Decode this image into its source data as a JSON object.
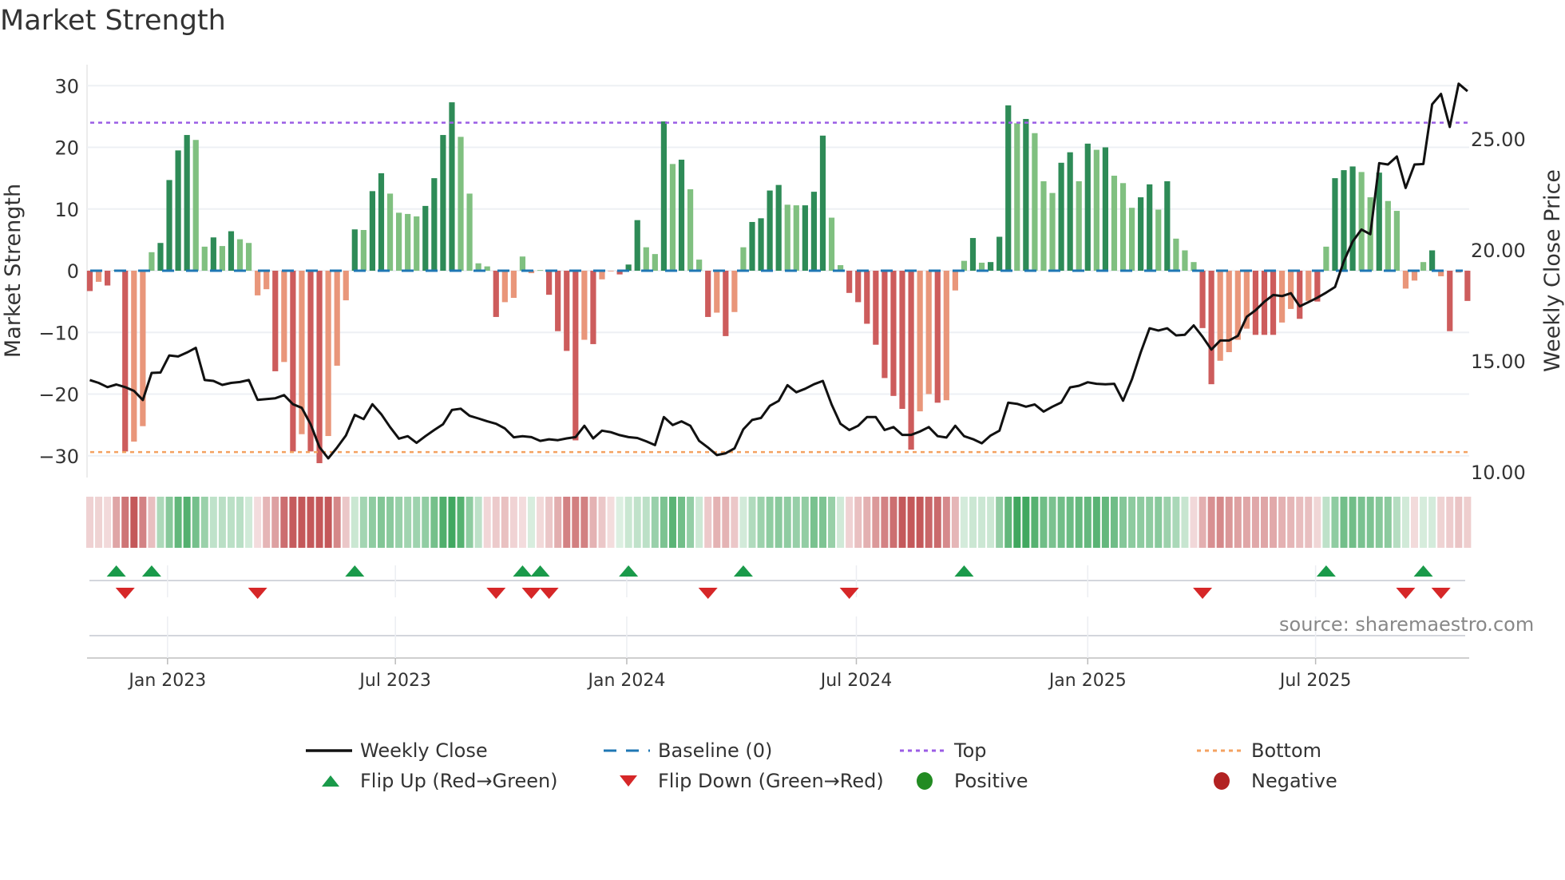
{
  "title": "Market Strength",
  "source": "source: sharemaestro.com",
  "colors": {
    "bar_pos_strong": "#2e8b57",
    "bar_pos_weak": "#80c080",
    "bar_neg_strong": "#cd5c5c",
    "bar_neg_weak": "#e9967a",
    "heat_pos": "#3fa75e",
    "heat_neg": "#c4585a",
    "close": "#111111",
    "baseline": "#1f77b4",
    "top": "#9b5de5",
    "bottom": "#f4a261",
    "flip_up": "#1a9a4a",
    "flip_down": "#d62728",
    "positive": "#228b22",
    "negative": "#b22222"
  },
  "legend": [
    {
      "key": "close",
      "label": "Weekly Close",
      "symbol": "line"
    },
    {
      "key": "baseline",
      "label": "Baseline (0)",
      "symbol": "dash"
    },
    {
      "key": "top",
      "label": "Top",
      "symbol": "dot"
    },
    {
      "key": "bottom",
      "label": "Bottom",
      "symbol": "dot"
    },
    {
      "key": "flip_up",
      "label": "Flip Up (Red→Green)",
      "symbol": "up"
    },
    {
      "key": "flip_down",
      "label": "Flip Down (Green→Red)",
      "symbol": "down"
    },
    {
      "key": "positive",
      "label": "Positive",
      "symbol": "circle"
    },
    {
      "key": "negative",
      "label": "Negative",
      "symbol": "circle"
    }
  ],
  "chart_data": {
    "type": "bar",
    "title": "Market Strength",
    "ylabel": "Market Strength",
    "y2label": "Weekly Close Price",
    "ylim": [
      -33.6,
      33.4
    ],
    "yticks": [
      "30",
      "20",
      "10",
      "0",
      "−10",
      "−20",
      "−30"
    ],
    "ytick_values": [
      30,
      20,
      10,
      0,
      -10,
      -20,
      -30
    ],
    "y2ticks": [
      "25.00",
      "20.00",
      "15.00",
      "10.00"
    ],
    "y2tick_values": [
      25,
      20,
      15,
      10
    ],
    "x_frequency": "weekly",
    "xticks": [
      {
        "label": "Jan 2023",
        "week_index": 8.8
      },
      {
        "label": "Jul 2023",
        "week_index": 34.6
      },
      {
        "label": "Jan 2024",
        "week_index": 60.8
      },
      {
        "label": "Jul 2024",
        "week_index": 86.8
      },
      {
        "label": "Jan 2025",
        "week_index": 113.0
      },
      {
        "label": "Jul 2025",
        "week_index": 138.8
      }
    ],
    "top_level": 24,
    "bottom_level": -29.4,
    "baseline": 0,
    "strength": [
      -3.3,
      -1.8,
      -2.4,
      0.1,
      -29.3,
      -27.7,
      -25.2,
      3,
      4.5,
      14.7,
      19.5,
      22,
      21.2,
      3.9,
      5.4,
      4,
      6.4,
      5.1,
      4.5,
      -4,
      -3,
      -16.3,
      -14.8,
      -29.3,
      -26.5,
      -29.3,
      -31.2,
      -26.8,
      -15.4,
      -4.8,
      6.7,
      6.6,
      12.9,
      15.8,
      12.5,
      9.4,
      9.2,
      8.8,
      10.5,
      15,
      22,
      27.3,
      21.7,
      12.5,
      1.2,
      0.7,
      -7.5,
      -5.1,
      -4.4,
      2.3,
      -0.4,
      0.1,
      -3.9,
      -9.8,
      -13,
      -27.5,
      -11.2,
      -11.9,
      -1.4,
      -0.1,
      -0.6,
      1,
      8.2,
      3.8,
      2.7,
      24.2,
      17.3,
      18,
      13.2,
      1.8,
      -7.5,
      -6.8,
      -10.6,
      -6.7,
      3.8,
      7.9,
      8.5,
      13,
      13.9,
      10.7,
      10.6,
      10.6,
      12.8,
      21.9,
      8.6,
      0.9,
      -3.6,
      -5.1,
      -8.6,
      -12,
      -17.4,
      -20.3,
      -22.4,
      -29,
      -22.8,
      -20,
      -21.4,
      -21,
      -3.2,
      1.6,
      5.3,
      1.3,
      1.4,
      5.5,
      26.8,
      23.9,
      24.6,
      22.3,
      14.5,
      12.6,
      17.5,
      19.2,
      14.5,
      20.6,
      19.6,
      20.0,
      15.4,
      14.2,
      10.2,
      11.9,
      14,
      9.9,
      14.5,
      5.2,
      3.3,
      1.4,
      -9.3,
      -18.4,
      -14.6,
      -13.2,
      -11.2,
      -9.4,
      -10.4,
      -10.4,
      -10.4,
      -8.4,
      -6.2,
      -7.8,
      -4.9,
      -5,
      3.9,
      15,
      16.3,
      16.9,
      16.0,
      11.9,
      15.9,
      11.3,
      9.7,
      -2.9,
      -1.6,
      1.4,
      3.3,
      -0.9,
      -9.8,
      -0.3,
      -4.9
    ],
    "close": [
      14.14,
      14.01,
      13.82,
      13.94,
      13.82,
      13.65,
      13.24,
      14.46,
      14.48,
      15.25,
      15.2,
      15.38,
      15.59,
      14.14,
      14.1,
      13.92,
      14.01,
      14.05,
      14.14,
      13.25,
      13.28,
      13.32,
      13.46,
      13.05,
      12.89,
      12.15,
      11.12,
      10.61,
      11.1,
      11.64,
      12.57,
      12.38,
      13.05,
      12.6,
      12.02,
      11.5,
      11.61,
      11.31,
      11.61,
      11.89,
      12.15,
      12.79,
      12.85,
      12.53,
      12.41,
      12.28,
      12.17,
      11.96,
      11.56,
      11.61,
      11.57,
      11.4,
      11.47,
      11.43,
      11.51,
      11.57,
      12.08,
      11.51,
      11.86,
      11.79,
      11.66,
      11.57,
      11.53,
      11.38,
      11.21,
      12.47,
      12.11,
      12.28,
      12.08,
      11.4,
      11.1,
      10.76,
      10.84,
      11.06,
      11.92,
      12.34,
      12.43,
      12.98,
      13.2,
      13.91,
      13.59,
      13.75,
      13.95,
      14.1,
      13.04,
      12.17,
      11.89,
      12.08,
      12.47,
      12.47,
      11.89,
      12.02,
      11.67,
      11.67,
      11.82,
      12.02,
      11.61,
      11.55,
      12.08,
      11.61,
      11.48,
      11.29,
      11.64,
      11.86,
      13.12,
      13.07,
      12.94,
      13.04,
      12.72,
      12.94,
      13.13,
      13.81,
      13.88,
      14.04,
      13.97,
      13.95,
      13.97,
      13.21,
      14.17,
      15.38,
      16.47,
      16.37,
      16.47,
      16.15,
      16.18,
      16.6,
      16.09,
      15.51,
      15.92,
      15.92,
      16.13,
      16.99,
      17.28,
      17.67,
      17.97,
      17.92,
      18.05,
      17.46,
      17.65,
      17.85,
      18.08,
      18.33,
      19.49,
      20.38,
      20.92,
      20.71,
      23.91,
      23.85,
      24.21,
      22.79,
      23.85,
      23.87,
      26.56,
      27.03,
      25.54,
      27.49,
      27.15
    ],
    "flip_up_weeks": [
      3,
      7,
      30,
      49,
      51,
      61,
      74,
      99,
      140,
      151
    ],
    "flip_down_weeks": [
      4,
      19,
      46,
      50,
      52,
      70,
      86,
      126,
      149,
      153
    ]
  }
}
